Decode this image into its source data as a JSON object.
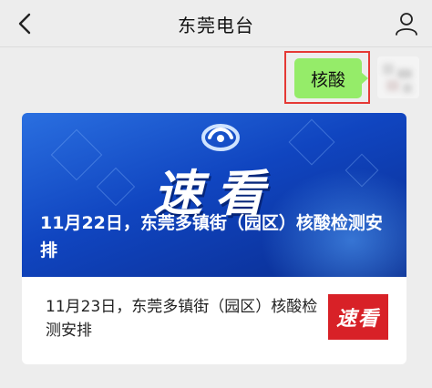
{
  "header": {
    "title": "东莞电台",
    "back_icon": "chevron-left-icon",
    "profile_icon": "person-icon"
  },
  "message": {
    "text": "核酸",
    "bubble_color": "#95ec69",
    "highlight_color": "#e53935"
  },
  "article_card": {
    "banner_title": "速看",
    "banner_text": "11月22日，东莞多镇街（园区）核酸检测安排",
    "sub_item": {
      "text": "11月23日，东莞多镇街（园区）核酸检测安排",
      "thumb_text": "速看",
      "thumb_color": "#d82127"
    }
  }
}
